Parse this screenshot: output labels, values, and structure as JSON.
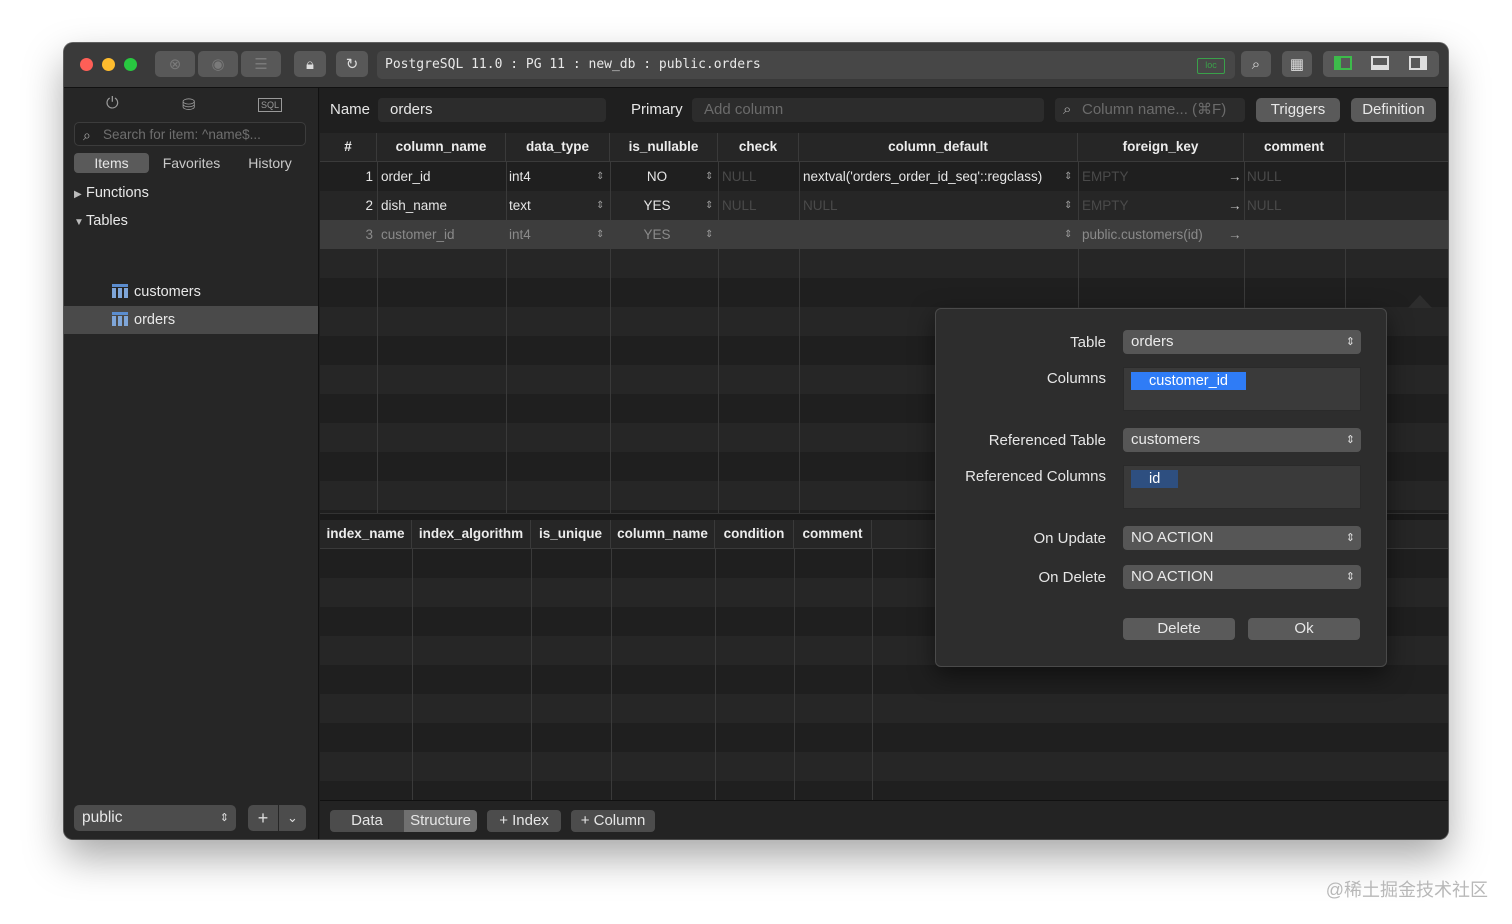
{
  "window": {
    "address": "PostgreSQL 11.0 : PG 11 : new_db : public.orders",
    "loc_badge": "loc"
  },
  "sidebar": {
    "search_placeholder": "Search for item: ^name$...",
    "tabs": [
      "Items",
      "Favorites",
      "History"
    ],
    "functions_label": "Functions",
    "tables_label": "Tables",
    "tables": [
      "customers",
      "orders"
    ],
    "schema": "public",
    "add_label": "+",
    "chevron": "⌄"
  },
  "toolbar": {
    "name_label": "Name",
    "name_value": "orders",
    "primary_label": "Primary",
    "primary_placeholder": "Add column",
    "column_search_placeholder": "Column name... (⌘F)",
    "triggers_label": "Triggers",
    "definition_label": "Definition"
  },
  "columns_table": {
    "headers": [
      "#",
      "column_name",
      "data_type",
      "is_nullable",
      "check",
      "column_default",
      "foreign_key",
      "comment"
    ],
    "rows": [
      {
        "num": "1",
        "column_name": "order_id",
        "data_type": "int4",
        "is_nullable": "NO",
        "check": "NULL",
        "column_default": "nextval('orders_order_id_seq'::regclass)",
        "foreign_key": "EMPTY",
        "comment": "NULL"
      },
      {
        "num": "2",
        "column_name": "dish_name",
        "data_type": "text",
        "is_nullable": "YES",
        "check": "NULL",
        "column_default": "NULL",
        "foreign_key": "EMPTY",
        "comment": "NULL"
      },
      {
        "num": "3",
        "column_name": "customer_id",
        "data_type": "int4",
        "is_nullable": "YES",
        "check": "",
        "column_default": "",
        "foreign_key": "public.customers(id)",
        "comment": ""
      }
    ]
  },
  "index_table": {
    "headers": [
      "index_name",
      "index_algorithm",
      "is_unique",
      "column_name",
      "condition",
      "comment"
    ]
  },
  "fk_popup": {
    "table_label": "Table",
    "table_value": "orders",
    "columns_label": "Columns",
    "columns_value": "customer_id",
    "ref_table_label": "Referenced Table",
    "ref_table_value": "customers",
    "ref_columns_label": "Referenced Columns",
    "ref_columns_value": "id",
    "on_update_label": "On Update",
    "on_update_value": "NO ACTION",
    "on_delete_label": "On Delete",
    "on_delete_value": "NO ACTION",
    "delete_label": "Delete",
    "ok_label": "Ok"
  },
  "bottom": {
    "data_tab": "Data",
    "structure_tab": "Structure",
    "index_button": "+ Index",
    "column_button": "+ Column"
  },
  "watermark": "@稀土掘金技术社区",
  "colors": {
    "selected_chip": "#2f7cf6",
    "secondary_chip": "#2e4f80"
  }
}
